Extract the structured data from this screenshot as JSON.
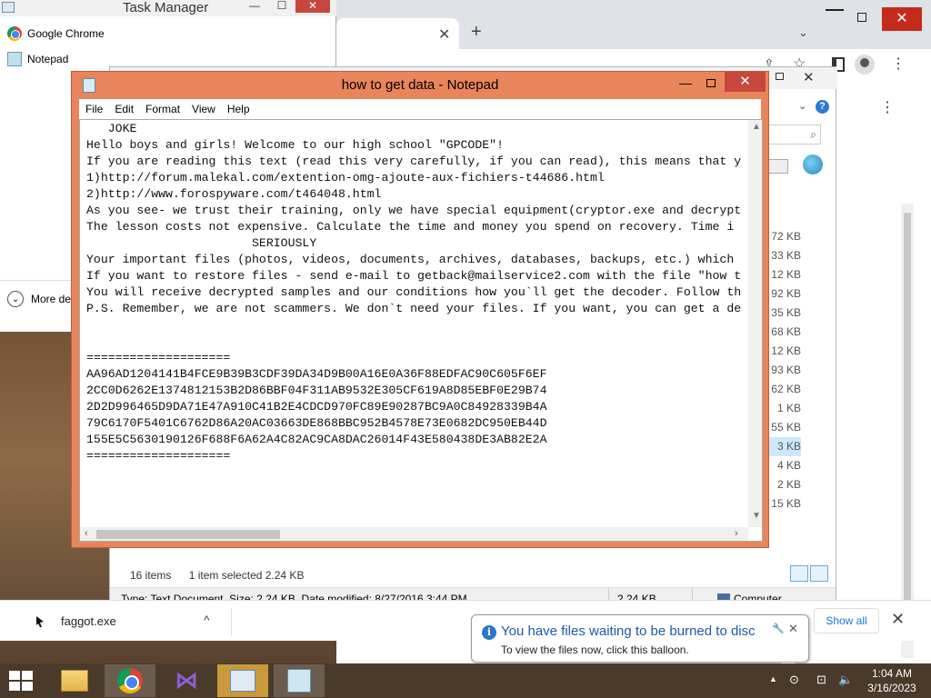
{
  "task_manager": {
    "title": "Task Manager",
    "apps": [
      "Google Chrome",
      "Notepad"
    ],
    "more_details": "More de"
  },
  "notepad": {
    "title": "how to get data - Notepad",
    "menu": [
      "File",
      "Edit",
      "Format",
      "View",
      "Help"
    ],
    "lines": [
      "   JOKE",
      "Hello boys and girls! Welcome to our high school \"GPCODE\"!",
      "If you are reading this text (read this very carefully, if you can read), this means that y",
      "1)http://forum.malekal.com/extention-omg-ajoute-aux-fichiers-t44686.html",
      "2)http://www.forospyware.com/t464048.html",
      "As you see- we trust their training, only we have special equipment(cryptor.exe and decrypt",
      "The lesson costs not expensive. Calculate the time and money you spend on recovery. Time i",
      "                       SERIOUSLY",
      "Your important files (photos, videos, documents, archives, databases, backups, etc.) which",
      "If you want to restore files - send e-mail to getback@mailservice2.com with the file \"how t",
      "You will receive decrypted samples and our conditions how you`ll get the decoder. Follow th",
      "P.S. Remember, we are not scammers. We don`t need your files. If you want, you can get a de",
      "",
      "",
      "====================",
      "AA96AD1204141B4FCE9B39B3CDF39DA34D9B00A16E0A36F88EDFAC90C605F6EF",
      "2CC0D6262E1374812153B2D86BBF04F311AB9532E305CF619A8D85EBF0E29B74",
      "2D2D996465D9DA71E47A910C41B2E4CDCD970FC89E90287BC9A0C84928339B4A",
      "79C6170F5401C6762D86A20AC03663DE868BBC952B4578E73E0682DC950EB44D",
      "155E5C5630190126F688F6A62A4C82AC9CA8DAC26014F43E580438DE3AB82E2A",
      "===================="
    ]
  },
  "explorer": {
    "sizes": [
      "72 KB",
      "33 KB",
      "12 KB",
      "92 KB",
      "35 KB",
      "68 KB",
      "12 KB",
      "93 KB",
      "62 KB",
      "1 KB",
      "55 KB",
      "3 KB",
      "4 KB",
      "2 KB",
      "15 KB"
    ],
    "selected_index": 11,
    "item_count": "16 items",
    "selection": "1 item selected  2.24 KB",
    "details": "Type: Text Document, Size: 2.24 KB, Date modified: 8/27/2016 3:44 PM",
    "size_cell": "2.24 KB",
    "location": "Computer"
  },
  "download_bar": {
    "filename": "faggot.exe",
    "show_all": "Show all"
  },
  "balloon": {
    "title": "You have files waiting to be burned to disc",
    "message": "To view the files now, click this balloon."
  },
  "taskbar": {
    "time": "1:04 AM",
    "date": "3/16/2023"
  },
  "colors": {
    "notepad_frame": "#e9855b",
    "close_red": "#c7473c",
    "chrome_close": "#c42b1c",
    "balloon_title": "#1e5aa8",
    "link_blue": "#1a73e8"
  }
}
